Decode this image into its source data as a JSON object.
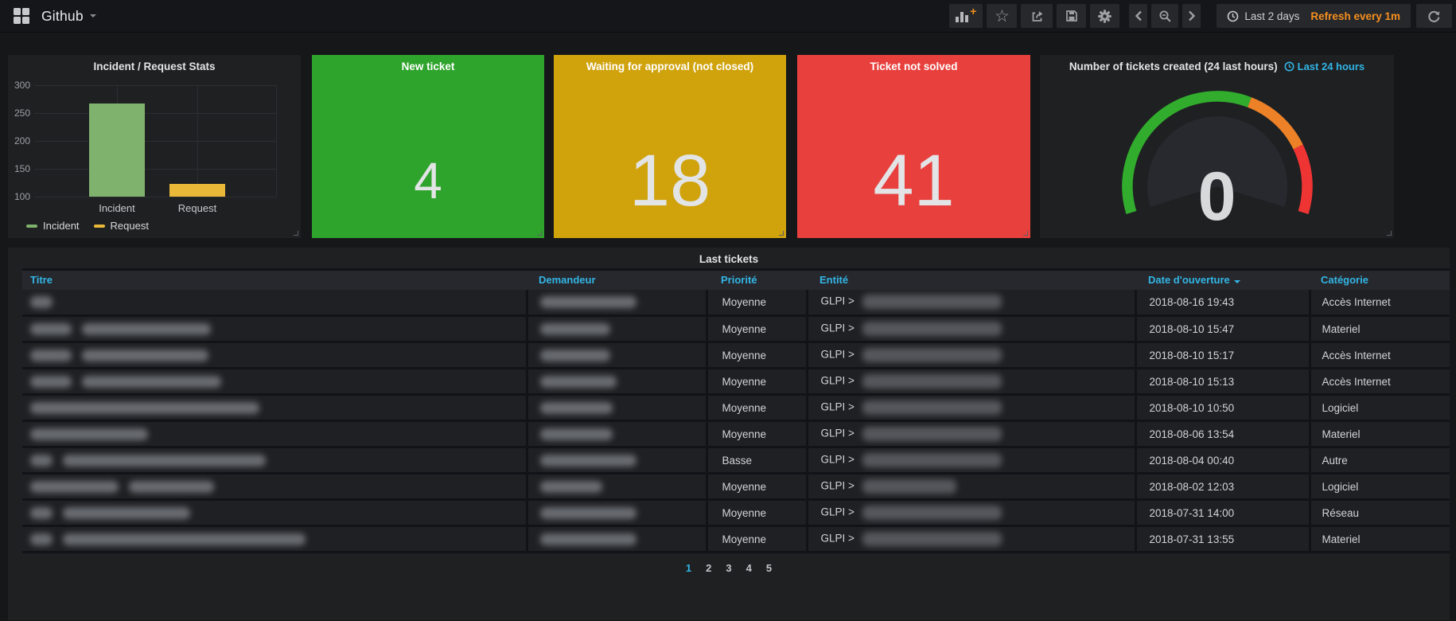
{
  "navbar": {
    "dashboard_title": "Github",
    "time_range": "Last 2 days",
    "refresh_interval": "Refresh every 1m"
  },
  "colors": {
    "accent_blue": "#33b5e5",
    "orange": "#f68f1f",
    "stat_green": "#2fa42c",
    "stat_yellow": "#d0a30d",
    "stat_red": "#e8403d",
    "gauge_green": "#32ac2d",
    "gauge_orange": "#ed8128",
    "gauge_red": "#ef3434"
  },
  "chart_data": {
    "type": "bar",
    "title": "Incident / Request Stats",
    "categories": [
      "Incident",
      "Request"
    ],
    "values": [
      267,
      123
    ],
    "series_colors": [
      "#7eb26d",
      "#eab839"
    ],
    "ylim": [
      100,
      300
    ],
    "yticks": [
      100,
      150,
      200,
      250,
      300
    ],
    "legend": [
      "Incident",
      "Request"
    ],
    "grid": true,
    "legend_position": "bottom-left"
  },
  "stats": [
    {
      "title": "New ticket",
      "value": "4",
      "bg": "#2fa42c",
      "size": "small"
    },
    {
      "title": "Waiting for approval (not closed)",
      "value": "18",
      "bg": "#d0a30d",
      "size": "large"
    },
    {
      "title": "Ticket not solved",
      "value": "41",
      "bg": "#e8403d",
      "size": "large"
    }
  ],
  "gauge": {
    "title": "Number of tickets created (24 last hours)",
    "link_label": "Last 24 hours",
    "value": "0"
  },
  "table": {
    "title": "Last tickets",
    "columns": [
      "Titre",
      "Demandeur",
      "Priorité",
      "Entité",
      "Date d'ouverture",
      "Catégorie"
    ],
    "sorted_column": "Date d'ouverture",
    "entite_prefix": "GLPI >",
    "rows": [
      {
        "titre_redact": [
          28
        ],
        "demandeur_w": 121,
        "priorite": "Moyenne",
        "entite_w": 175,
        "date": "2018-08-16 19:43",
        "categorie": "Accès Internet"
      },
      {
        "titre_redact": [
          52,
          162
        ],
        "demandeur_w": 88,
        "priorite": "Moyenne",
        "entite_w": 175,
        "date": "2018-08-10 15:47",
        "categorie": "Materiel"
      },
      {
        "titre_redact": [
          52,
          159
        ],
        "demandeur_w": 88,
        "priorite": "Moyenne",
        "entite_w": 175,
        "date": "2018-08-10 15:17",
        "categorie": "Accès Internet"
      },
      {
        "titre_redact": [
          52,
          175
        ],
        "demandeur_w": 96,
        "priorite": "Moyenne",
        "entite_w": 175,
        "date": "2018-08-10 15:13",
        "categorie": "Accès Internet"
      },
      {
        "titre_redact": [
          288
        ],
        "demandeur_w": 91,
        "priorite": "Moyenne",
        "entite_w": 175,
        "date": "2018-08-10 10:50",
        "categorie": "Logiciel"
      },
      {
        "titre_redact": [
          148
        ],
        "demandeur_w": 91,
        "priorite": "Moyenne",
        "entite_w": 175,
        "date": "2018-08-06 13:54",
        "categorie": "Materiel"
      },
      {
        "titre_redact": [
          28,
          255
        ],
        "demandeur_w": 121,
        "priorite": "Basse",
        "entite_w": 175,
        "date": "2018-08-04 00:40",
        "categorie": "Autre"
      },
      {
        "titre_redact": [
          111,
          107
        ],
        "demandeur_w": 78,
        "priorite": "Moyenne",
        "entite_w": 118,
        "date": "2018-08-02 12:03",
        "categorie": "Logiciel"
      },
      {
        "titre_redact": [
          28,
          160
        ],
        "demandeur_w": 121,
        "priorite": "Moyenne",
        "entite_w": 175,
        "date": "2018-07-31 14:00",
        "categorie": "Réseau"
      },
      {
        "titre_redact": [
          28,
          305
        ],
        "demandeur_w": 121,
        "priorite": "Moyenne",
        "entite_w": 175,
        "date": "2018-07-31 13:55",
        "categorie": "Materiel"
      }
    ],
    "pagination": [
      "1",
      "2",
      "3",
      "4",
      "5"
    ],
    "active_page": "1"
  }
}
